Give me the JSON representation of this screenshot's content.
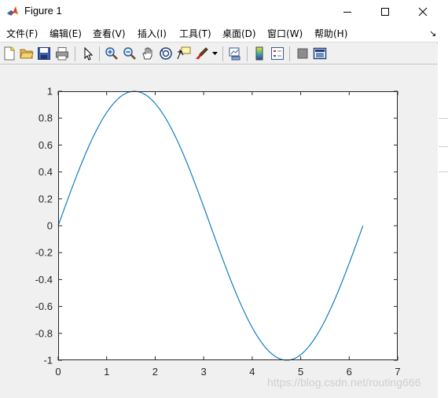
{
  "window": {
    "title": "Figure 1"
  },
  "menu": {
    "items": [
      "文件(F)",
      "编辑(E)",
      "查看(V)",
      "插入(I)",
      "工具(T)",
      "桌面(D)",
      "窗口(W)",
      "帮助(H)"
    ]
  },
  "toolbar": {
    "icons": [
      "new-figure-icon",
      "open-file-icon",
      "save-icon",
      "print-icon",
      "pointer-icon",
      "zoom-in-icon",
      "zoom-out-icon",
      "pan-icon",
      "rotate-3d-icon",
      "data-cursor-icon",
      "brush-icon",
      "link-plot-icon",
      "colorbar-icon",
      "legend-icon",
      "hide-plot-tools-icon",
      "show-plot-tools-icon"
    ]
  },
  "colors": {
    "line": "#0072bd",
    "figure_bg": "#f0f0f0",
    "axes_bg": "#ffffff"
  },
  "chart_data": {
    "type": "line",
    "function": "sin(x)",
    "x_range": [
      0,
      6.2832
    ],
    "series": [
      {
        "x_start": 0,
        "x_end": 6.2832,
        "samples": 100
      }
    ],
    "xlim": [
      0,
      7
    ],
    "ylim": [
      -1,
      1
    ],
    "xticks": [
      "0",
      "1",
      "2",
      "3",
      "4",
      "5",
      "6",
      "7"
    ],
    "xtick_values": [
      0,
      1,
      2,
      3,
      4,
      5,
      6,
      7
    ],
    "yticks": [
      "-1",
      "-0.8",
      "-0.6",
      "-0.4",
      "-0.2",
      "0",
      "0.2",
      "0.4",
      "0.6",
      "0.8",
      "1"
    ],
    "ytick_values": [
      -1,
      -0.8,
      -0.6,
      -0.4,
      -0.2,
      0,
      0.2,
      0.4,
      0.6,
      0.8,
      1
    ],
    "grid": false,
    "title": "",
    "xlabel": "",
    "ylabel": ""
  },
  "watermark": "https://blog.csdn.net/routing666"
}
